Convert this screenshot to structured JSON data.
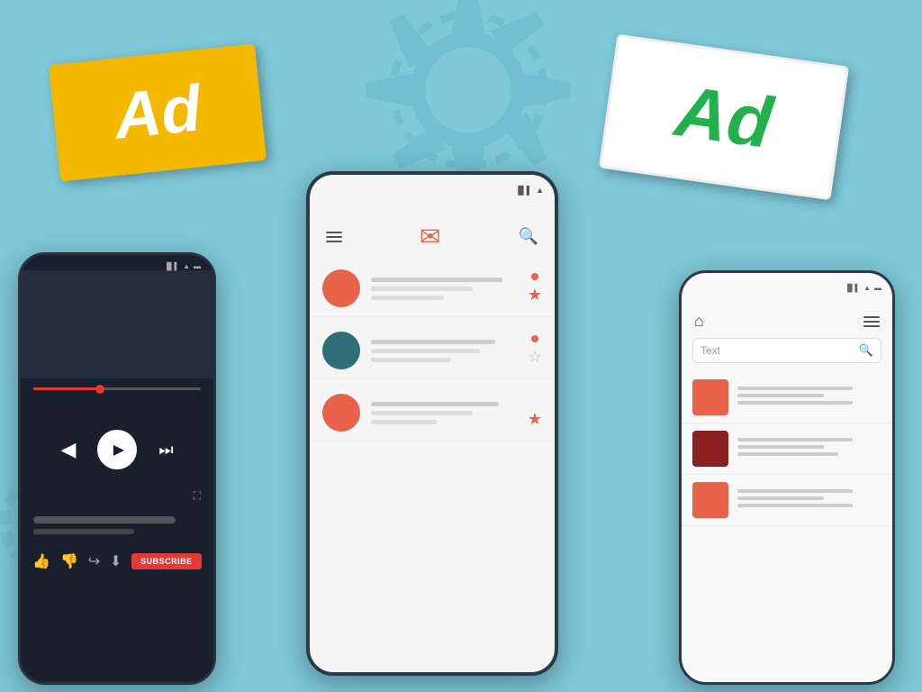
{
  "background": {
    "color": "#7ec8d8"
  },
  "ad_banners": {
    "yellow": {
      "text": "Ad",
      "bg_color": "#f5b800",
      "text_color": "white"
    },
    "green": {
      "text": "Ad",
      "bg_color": "white",
      "text_color": "#22b14c"
    }
  },
  "phone_left": {
    "type": "video_player",
    "bg_color": "#1a1f2e",
    "controls": {
      "prev_label": "⏮",
      "play_label": "▶",
      "next_label": "⏭"
    },
    "progress": 40,
    "actions": [
      "👍",
      "👎",
      "↪",
      "⬇"
    ],
    "subscribe_label": "SUBSCRIBE"
  },
  "phone_center": {
    "type": "email_list",
    "bg_color": "#f5f5f5",
    "header": {
      "menu_label": "☰",
      "email_icon": "✉",
      "search_icon": "🔍"
    },
    "items": [
      {
        "avatar_color": "#e8634a",
        "starred": true,
        "has_dot": true
      },
      {
        "avatar_color": "#2e6e78",
        "starred": false,
        "has_dot": true
      },
      {
        "avatar_color": "#e8634a",
        "starred": true,
        "has_dot": false
      }
    ]
  },
  "phone_right": {
    "type": "text_list",
    "bg_color": "#f8f8f8",
    "header": {
      "home_icon": "⌂",
      "menu_icon": "≡"
    },
    "search": {
      "placeholder": "Text",
      "search_icon": "🔍"
    },
    "items": [
      {
        "thumb_color": "#e8634a"
      },
      {
        "thumb_color": "#8b2020"
      },
      {
        "thumb_color": "#e8634a"
      }
    ]
  },
  "status_bar": {
    "signal": "▐▌▌",
    "wifi": "▲",
    "battery": "▬"
  }
}
